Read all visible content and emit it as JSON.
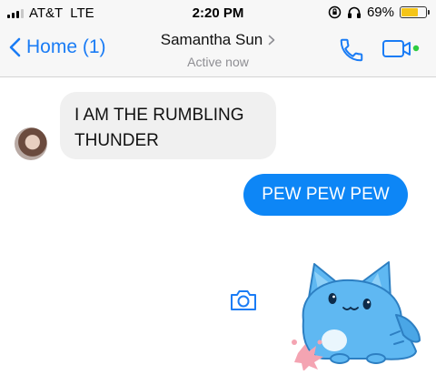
{
  "status_bar": {
    "carrier": "AT&T",
    "network": "LTE",
    "time": "2:20 PM",
    "battery_percent": "69%",
    "battery_level": 0.69,
    "battery_color": "#f5c518"
  },
  "nav": {
    "back_label": "Home (1)",
    "contact_name": "Samantha Sun",
    "contact_status": "Active now",
    "accent_color": "#1a7cf5",
    "active_dot_color": "#2ecc40"
  },
  "messages": [
    {
      "from": "them",
      "text": "I AM THE RUMBLING\nTHUNDER"
    },
    {
      "from": "me",
      "text": "PEW PEW PEW",
      "bubble_color": "#0d86f6"
    }
  ],
  "icons": {
    "signal": "signal-bars-icon",
    "orientation_lock": "orientation-lock-icon",
    "headphones": "headphones-icon",
    "battery": "battery-icon",
    "back": "chevron-left-icon",
    "contact_chevron": "chevron-right-icon",
    "call": "phone-icon",
    "video": "video-camera-icon",
    "camera": "camera-icon",
    "sticker": "blue-cat-sticker"
  }
}
